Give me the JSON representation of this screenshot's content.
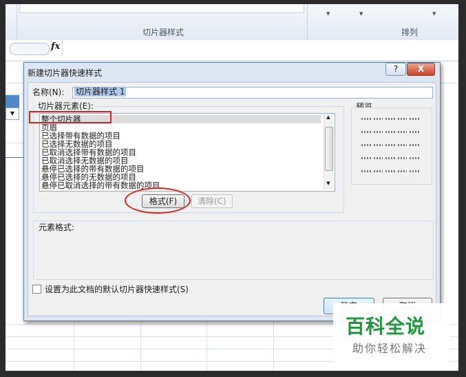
{
  "ribbon": {
    "group_slicer_styles": "切片器样式",
    "group_arrange": "排列"
  },
  "formula_bar": {
    "fx_label": "fx"
  },
  "dialog": {
    "title": "新建切片器快速样式",
    "help_label": "?",
    "close_label": "X",
    "name_label": "名称(N):",
    "name_value": "切片器样式 1",
    "elements_label": "切片器元素(E):",
    "elements": [
      "整个切片器",
      "页眉",
      "已选择带有数据的项目",
      "已选择无数据的项目",
      "已取消选择带有数据的项目",
      "已取消选择无数据的项目",
      "悬停已选择的带有数据的项目",
      "悬停已选择的无数据的项目",
      "悬停已取消选择的带有数据的项目"
    ],
    "selected_element_index": 0,
    "format_button": "格式(F)",
    "clear_button": "清除(C)",
    "preview_label": "预览",
    "element_format_label": "元素格式:",
    "default_checkbox_label": "设置为此文档的默认切片器快速样式(S)",
    "default_checkbox_checked": false,
    "ok_button": "确定",
    "cancel_button": "取消"
  },
  "watermark": {
    "title": "百科全说",
    "subtitle": "助你轻松解决",
    "color": "#1a9a3a"
  },
  "colors": {
    "annotation": "#e02020",
    "selection": "#aecbed"
  }
}
